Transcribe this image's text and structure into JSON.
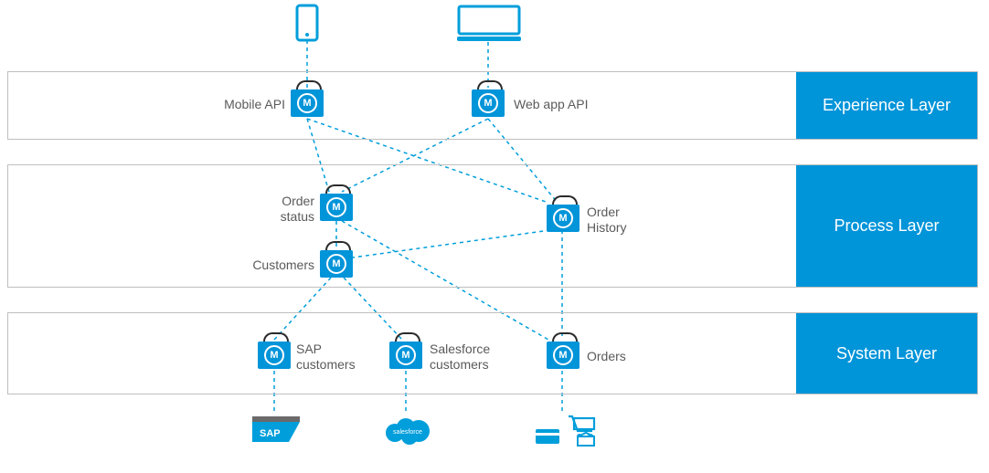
{
  "colors": {
    "accent": "#009edb",
    "accent_deep": "#0094d9",
    "text": "#5a5a5a",
    "border": "#bfbfbf"
  },
  "layers": {
    "experience": {
      "title": "Experience Layer"
    },
    "process": {
      "title": "Process Layer"
    },
    "system": {
      "title": "System Layer"
    }
  },
  "devices": {
    "mobile": {
      "name": "mobile-device-icon"
    },
    "desktop": {
      "name": "desktop-device-icon"
    }
  },
  "apis": {
    "mobile_api": {
      "label": "Mobile API"
    },
    "web_app_api": {
      "label": "Web app API"
    },
    "order_status": {
      "label": "Order status"
    },
    "order_history": {
      "label": "Order History"
    },
    "customers": {
      "label": "Customers"
    },
    "sap_customers": {
      "label": "SAP customers"
    },
    "salesforce_customers": {
      "label": "Salesforce customers"
    },
    "orders": {
      "label": "Orders"
    }
  },
  "backends": {
    "sap": {
      "label": "SAP"
    },
    "salesforce": {
      "label": "salesforce"
    },
    "commerce": {
      "name": "orders-backend"
    }
  },
  "connections": [
    [
      "mobile-device",
      "mobile_api"
    ],
    [
      "desktop-device",
      "web_app_api"
    ],
    [
      "mobile_api",
      "order_status"
    ],
    [
      "mobile_api",
      "order_history"
    ],
    [
      "web_app_api",
      "order_status"
    ],
    [
      "web_app_api",
      "order_history"
    ],
    [
      "order_status",
      "customers"
    ],
    [
      "order_status",
      "orders"
    ],
    [
      "order_history",
      "customers"
    ],
    [
      "order_history",
      "orders"
    ],
    [
      "customers",
      "sap_customers"
    ],
    [
      "customers",
      "salesforce_customers"
    ],
    [
      "sap_customers",
      "sap-backend"
    ],
    [
      "salesforce_customers",
      "salesforce-backend"
    ],
    [
      "orders",
      "commerce-backend"
    ]
  ]
}
